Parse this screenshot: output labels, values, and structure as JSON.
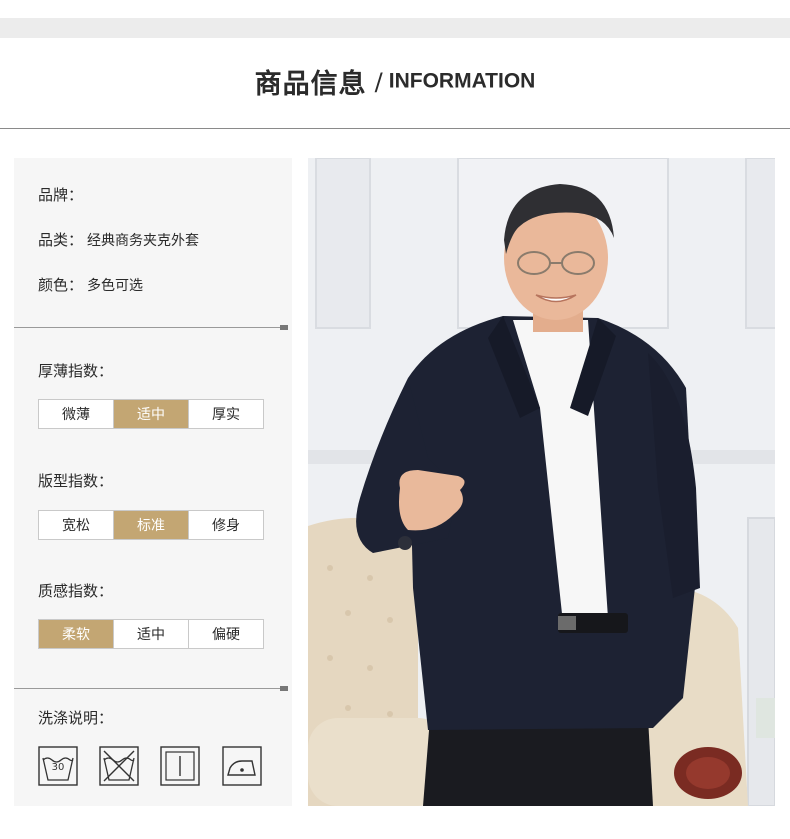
{
  "header": {
    "title_cn": "商品信息",
    "separator": "/",
    "title_en": "INFORMATION"
  },
  "basic_info": {
    "brand_label": "品牌：",
    "brand_value": "",
    "category_label": "品类：",
    "category_value": "经典商务夹克外套",
    "color_label": "颜色：",
    "color_value": "多色可选"
  },
  "thickness": {
    "label": "厚薄指数：",
    "options": [
      "微薄",
      "适中",
      "厚实"
    ],
    "selected": "适中"
  },
  "fit": {
    "label": "版型指数：",
    "options": [
      "宽松",
      "标准",
      "修身"
    ],
    "selected": "标准"
  },
  "texture": {
    "label": "质感指数：",
    "options": [
      "柔软",
      "适中",
      "偏硬"
    ],
    "selected": "柔软"
  },
  "care": {
    "label": "洗涤说明：",
    "wash_temp": "30",
    "icons": [
      "wash-30-icon",
      "no-bleach-icon",
      "tumble-dry-icon",
      "iron-low-icon"
    ]
  },
  "colors": {
    "accent": "#c3a673",
    "panel_bg": "#f6f6f6",
    "jacket": "#1d2233"
  }
}
